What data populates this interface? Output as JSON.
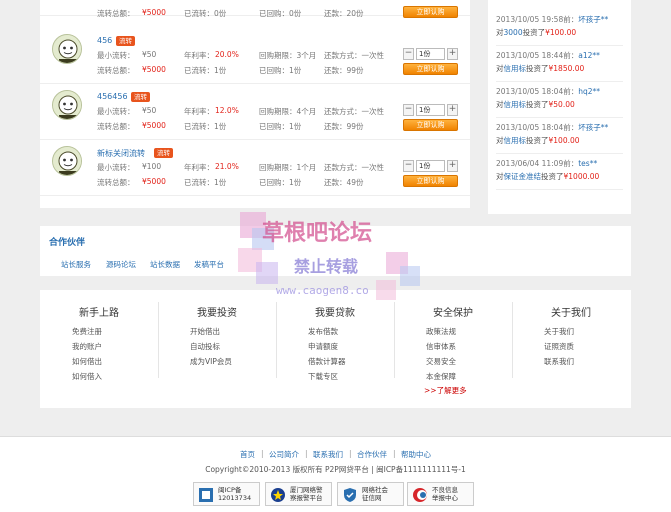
{
  "loans": [
    {
      "title": "",
      "badge": "",
      "min_label": "流转总额：",
      "min_value": "¥5000",
      "rate_label": "已流转：0份",
      "rate_value": "",
      "period": "已回购：0份",
      "repay": "还款：20份",
      "total_label": "",
      "total_value": "",
      "transferred": "",
      "bought": "",
      "remain": "",
      "qty": "",
      "buy": "立即认购",
      "partial": true
    },
    {
      "title": "456",
      "badge": "流转",
      "min_label": "最小流转：",
      "min_value": "¥50",
      "rate_label": "年利率：",
      "rate_value": "20.0%",
      "period": "回购期限：3个月",
      "repay": "还款方式：一次性",
      "total_label": "流转总额：",
      "total_value": "¥5000",
      "transferred": "已流转：1份",
      "bought": "已回购：1份",
      "remain": "还款：99份",
      "qty": "1份",
      "buy": "立即认购"
    },
    {
      "title": "456456",
      "badge": "流转",
      "min_label": "最小流转：",
      "min_value": "¥50",
      "rate_label": "年利率：",
      "rate_value": "12.0%",
      "period": "回购期限：4个月",
      "repay": "还款方式：一次性",
      "total_label": "流转总额：",
      "total_value": "¥5000",
      "transferred": "已流转：1份",
      "bought": "已回购：1份",
      "remain": "还款：99份",
      "qty": "1份",
      "buy": "立即认购"
    },
    {
      "title": "新标关闭流转",
      "badge": "流转",
      "min_label": "最小流转：",
      "min_value": "¥100",
      "rate_label": "年利率：",
      "rate_value": "21.0%",
      "period": "回购期限：1个月",
      "repay": "还款方式：一次性",
      "total_label": "流转总额：",
      "total_value": "¥5000",
      "transferred": "已流转：1份",
      "bought": "已回购：1份",
      "remain": "还款：49份",
      "qty": "1份",
      "buy": "立即认购"
    }
  ],
  "feed": [
    {
      "time": "2013/10/05 19:58前：",
      "user": "坏孩子**",
      "pre": "对",
      "product": "3000",
      "mid": "投资了",
      "amount": "¥100.00"
    },
    {
      "time": "2013/10/05 18:44前：",
      "user": "a12**",
      "pre": "对",
      "product": "信用标",
      "mid": "投资了",
      "amount": "¥1850.00"
    },
    {
      "time": "2013/10/05 18:04前：",
      "user": "hq2**",
      "pre": "对",
      "product": "信用标",
      "mid": "投资了",
      "amount": "¥50.00"
    },
    {
      "time": "2013/10/05 18:04前：",
      "user": "坏孩子**",
      "pre": "对",
      "product": "信用标",
      "mid": "投资了",
      "amount": "¥100.00"
    },
    {
      "time": "2013/06/04 11:09前：",
      "user": "tes**",
      "pre": "对",
      "product": "保证金准结",
      "mid": "投资了",
      "amount": "¥1000.00"
    }
  ],
  "partners": {
    "title": "合作伙伴",
    "links": [
      "站长服务",
      "源码论坛",
      "站长数据",
      "发稿平台"
    ]
  },
  "footer_columns": [
    {
      "title": "新手上路",
      "items": [
        "免费注册",
        "我的账户",
        "如何借出",
        "如何借入"
      ]
    },
    {
      "title": "我要投资",
      "items": [
        "开始借出",
        "自动投标",
        "成为VIP会员"
      ]
    },
    {
      "title": "我要贷款",
      "items": [
        "发布借款",
        "申请额度",
        "借款计算器",
        "下载专区"
      ]
    },
    {
      "title": "安全保护",
      "items": [
        "政策法规",
        "信审体系",
        "交易安全",
        "本金保障"
      ],
      "more": ">>了解更多"
    },
    {
      "title": "关于我们",
      "items": [
        "关于我们",
        "证照资质",
        "联系我们"
      ]
    }
  ],
  "bottom": {
    "nav": [
      "首页",
      "公司简介",
      "联系我们",
      "合作伙伴",
      "帮助中心"
    ],
    "separator": "|",
    "copyright": "Copyright©2010-2013 版权所有 P2P网贷平台 | 闽ICP备1111111111号-1",
    "certs": [
      {
        "line1": "闽ICP备",
        "line2": "12013734"
      },
      {
        "line1": "厦门网络警",
        "line2": "察报警平台"
      },
      {
        "line1": "网络社会",
        "line2": "征信网"
      },
      {
        "line1": "不良信息",
        "line2": "举报中心"
      }
    ]
  },
  "watermark": {
    "title": "草根吧论坛",
    "subtitle": "禁止转载",
    "url": "www.caogen8.co"
  },
  "colors": {
    "link": "#2a6fb0",
    "money": "#e2231a",
    "buy_button": "#f08300",
    "badge": "#e8541d"
  }
}
